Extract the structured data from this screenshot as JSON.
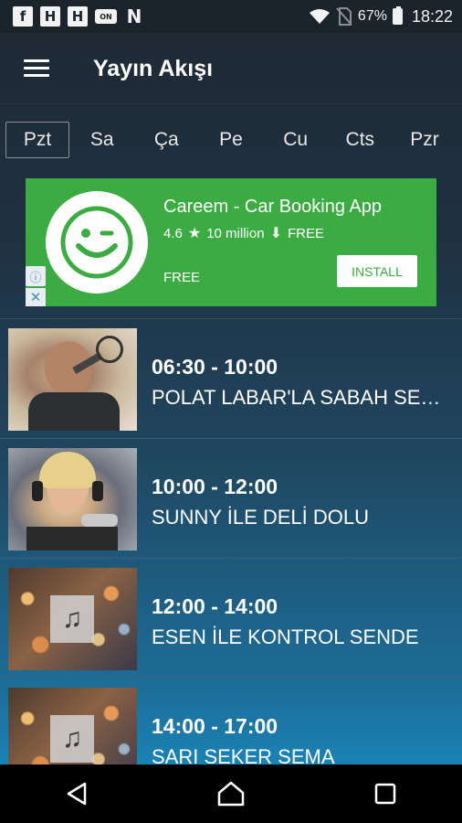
{
  "status_bar": {
    "battery": "67%",
    "time": "18:22",
    "notification_icons": [
      "facebook-icon",
      "h-app-icon",
      "h-app-icon",
      "news-app-icon",
      "n-app-icon"
    ]
  },
  "toolbar": {
    "title": "Yayın Akışı"
  },
  "day_tabs": [
    {
      "label": "Pzt",
      "active": true
    },
    {
      "label": "Sa",
      "active": false
    },
    {
      "label": "Ça",
      "active": false
    },
    {
      "label": "Pe",
      "active": false
    },
    {
      "label": "Cu",
      "active": false
    },
    {
      "label": "Cts",
      "active": false
    },
    {
      "label": "Pzr",
      "active": false
    }
  ],
  "ad": {
    "app_name": "Careem - Car Booking App",
    "rating": "4.6",
    "downloads": "10 million",
    "price": "FREE",
    "free_label": "FREE",
    "install_label": "INSTALL",
    "background_color": "#3aac41"
  },
  "schedule": [
    {
      "time": "06:30 - 10:00",
      "show": "POLAT LABAR'LA SABAH SEKERİ",
      "thumb": "host-photo"
    },
    {
      "time": "10:00 - 12:00",
      "show": "SUNNY İLE DELİ DOLU",
      "thumb": "host-photo"
    },
    {
      "time": "12:00 - 14:00",
      "show": "ESEN İLE KONTROL SENDE",
      "thumb": "music-placeholder"
    },
    {
      "time": "14:00 - 17:00",
      "show": "SARI SEKER SEMA",
      "thumb": "music-placeholder"
    }
  ],
  "colors": {
    "accent": "#1a82b5",
    "status_bar": "#1b232b"
  }
}
